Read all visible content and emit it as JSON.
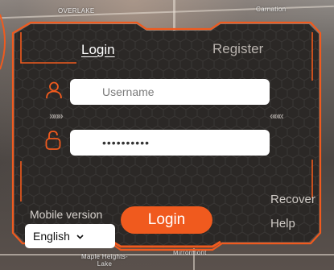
{
  "map": {
    "labels": [
      "OVERLAKE",
      "Carnation",
      "Maple Heights-Lake",
      "Mirrormont"
    ]
  },
  "tabs": {
    "login_label": "Login",
    "register_label": "Register"
  },
  "form": {
    "username_placeholder": "Username",
    "username_value": "",
    "password_value": "••••••••••"
  },
  "icons": {
    "user": "user-icon",
    "lock": "lock-icon",
    "left_arrows": "»»»",
    "right_arrows": "«««"
  },
  "footer": {
    "mobile_version_label": "Mobile version",
    "language_value": "English",
    "login_button_label": "Login",
    "recover_label": "Recover",
    "help_label": "Help"
  },
  "colors": {
    "accent": "#f05a1e",
    "panel_bg": "#2b2826"
  }
}
